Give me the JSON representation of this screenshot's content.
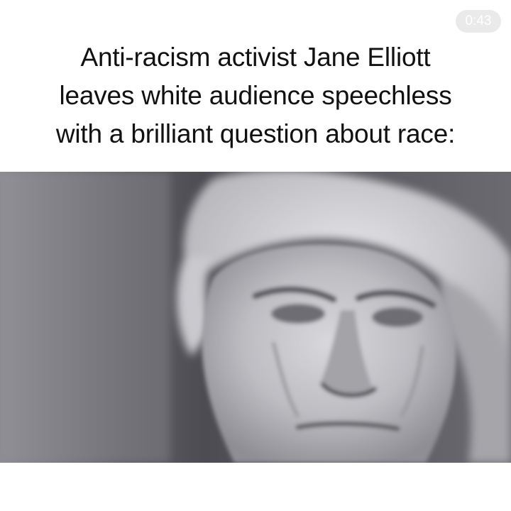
{
  "post": {
    "timer": "0:43",
    "caption_lines": [
      "Anti-racism activist Jane Elliott",
      "leaves white audience speechless",
      "with a brilliant question about race:"
    ]
  },
  "video": {
    "content": "grayscale close-up of an older woman's face"
  },
  "colors": {
    "background": "#ffffff",
    "caption_text": "#111111",
    "timer_text": "#ffffff"
  }
}
